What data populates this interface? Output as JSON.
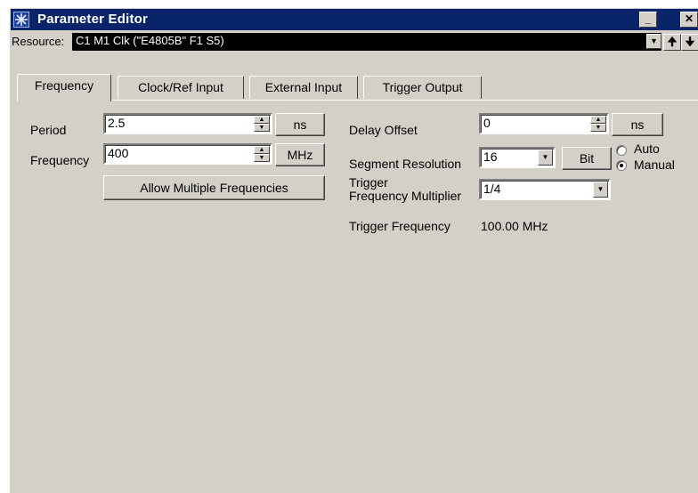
{
  "window": {
    "title": "Parameter Editor",
    "minimize_glyph": "_",
    "close_glyph": "✕"
  },
  "resource": {
    "label": "Resource:",
    "value": "C1 M1 Clk (\"E4805B\" F1 S5)",
    "up_glyph": "🠉",
    "down_glyph": "🠋"
  },
  "tabs": [
    {
      "label": "Frequency",
      "active": true
    },
    {
      "label": "Clock/Ref Input",
      "active": false
    },
    {
      "label": "External Input",
      "active": false
    },
    {
      "label": "Trigger Output",
      "active": false
    }
  ],
  "left": {
    "period_label": "Period",
    "period_value": "2.5",
    "period_unit": "ns",
    "frequency_label": "Frequency",
    "frequency_value": "400",
    "frequency_unit": "MHz",
    "allow_multiple_label": "Allow Multiple Frequencies"
  },
  "right": {
    "delay_offset_label": "Delay Offset",
    "delay_offset_value": "0",
    "delay_offset_unit": "ns",
    "segment_resolution_label": "Segment Resolution",
    "segment_resolution_value": "16",
    "segment_resolution_unit": "Bit",
    "mode_auto_label": "Auto",
    "mode_manual_label": "Manual",
    "mode_selected": "Manual",
    "trigger_multiplier_label_line1": "Trigger",
    "trigger_multiplier_label_line2": "Frequency Multiplier",
    "trigger_multiplier_value": "1/4",
    "trigger_frequency_label": "Trigger Frequency",
    "trigger_frequency_value": "100.00 MHz"
  }
}
